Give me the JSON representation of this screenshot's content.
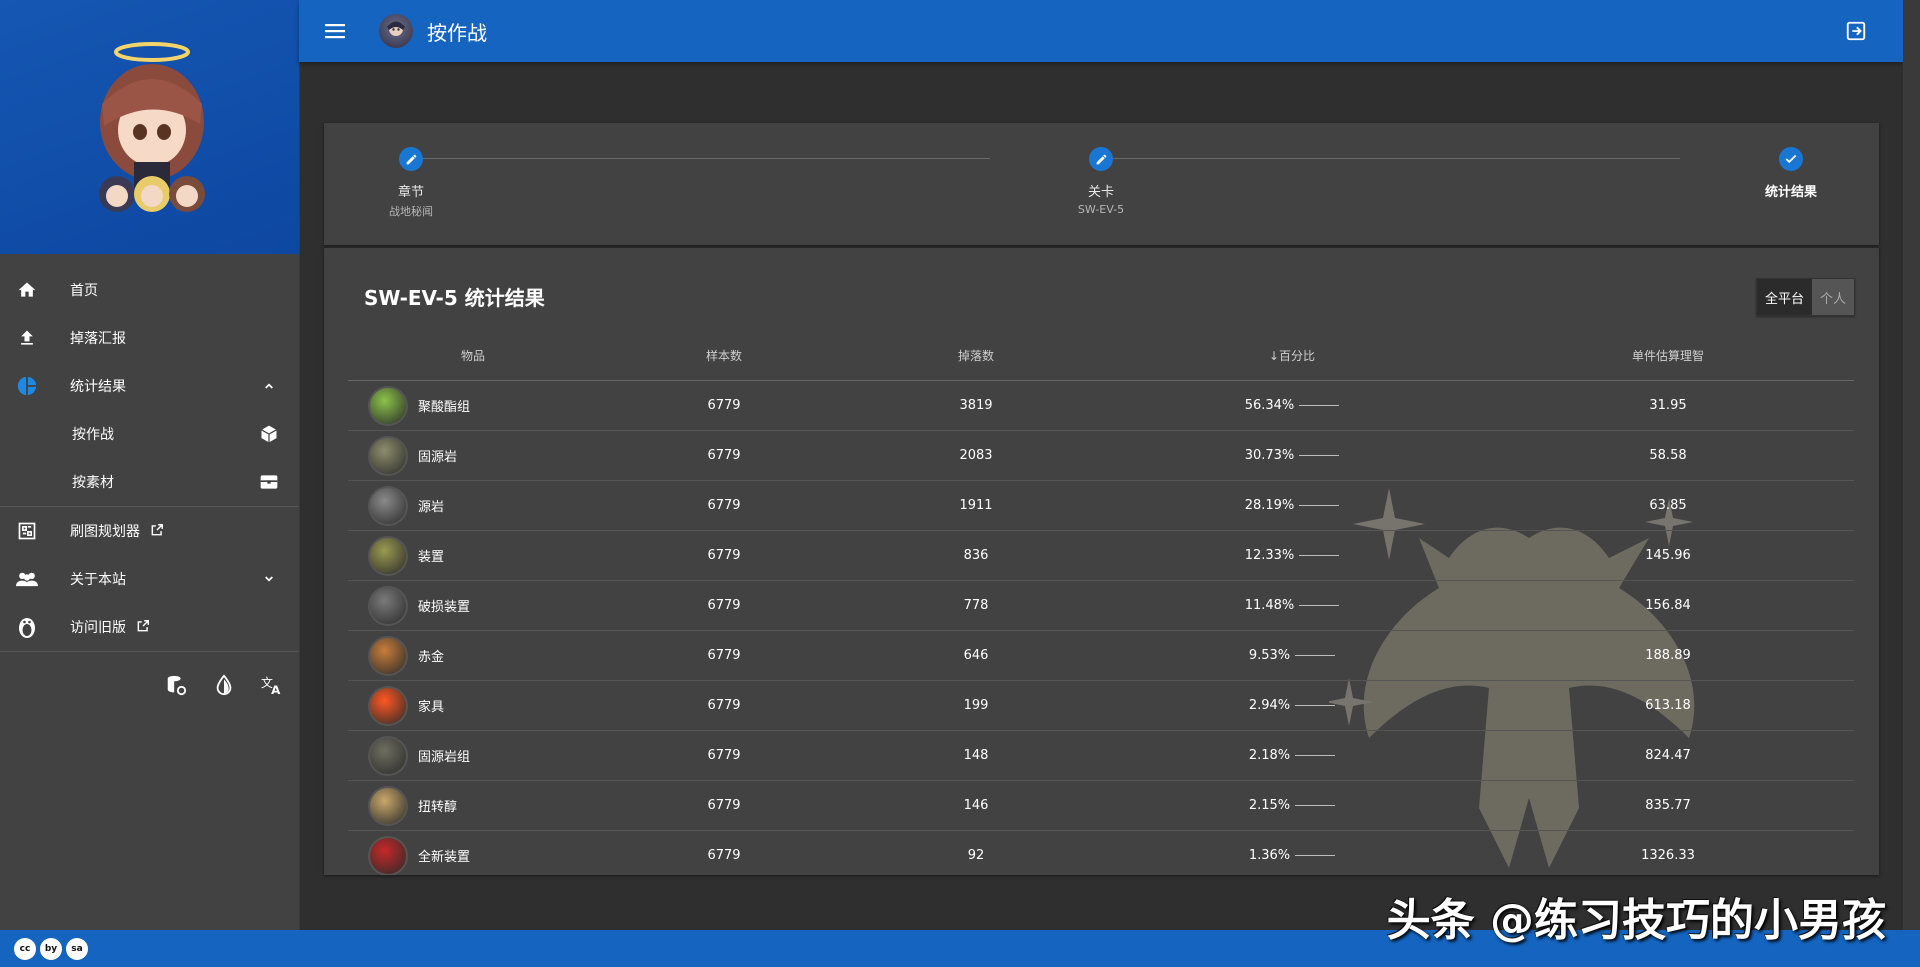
{
  "topbar": {
    "title": "按作战"
  },
  "sidebar": {
    "items": [
      {
        "label": "首页",
        "icon": "home-icon"
      },
      {
        "label": "掉落汇报",
        "icon": "upload-icon"
      },
      {
        "label": "统计结果",
        "icon": "pie-chart-icon",
        "expanded": true
      },
      {
        "label": "按作战",
        "icon": "cube-icon",
        "sub": true
      },
      {
        "label": "按素材",
        "icon": "box-icon",
        "sub": true
      },
      {
        "label": "刷图规划器",
        "icon": "planner-icon",
        "external": true
      },
      {
        "label": "关于本站",
        "icon": "people-icon"
      },
      {
        "label": "访问旧版",
        "icon": "penguin-icon",
        "external": true
      }
    ]
  },
  "stepper": {
    "steps": [
      {
        "label": "章节",
        "sub": "战地秘闻"
      },
      {
        "label": "关卡",
        "sub": "SW-EV-5"
      },
      {
        "label": "统计结果",
        "sub": ""
      }
    ]
  },
  "results": {
    "title": "SW-EV-5 统计结果",
    "toggle": {
      "all": "全平台",
      "personal": "个人"
    },
    "headers": {
      "item": "物品",
      "samples": "样本数",
      "drops": "掉落数",
      "percent": "百分比",
      "sanity": "单件估算理智"
    },
    "rows": [
      {
        "name": "聚酸酯组",
        "samples": "6779",
        "drops": "3819",
        "percent": "56.34%",
        "sanity": "31.95",
        "color": "#8bc34a"
      },
      {
        "name": "固源岩",
        "samples": "6779",
        "drops": "2083",
        "percent": "30.73%",
        "sanity": "58.58",
        "color": "#8d8d6b"
      },
      {
        "name": "源岩",
        "samples": "6779",
        "drops": "1911",
        "percent": "28.19%",
        "sanity": "63.85",
        "color": "#8a8a8a"
      },
      {
        "name": "装置",
        "samples": "6779",
        "drops": "836",
        "percent": "12.33%",
        "sanity": "145.96",
        "color": "#9a9a50"
      },
      {
        "name": "破损装置",
        "samples": "6779",
        "drops": "778",
        "percent": "11.48%",
        "sanity": "156.84",
        "color": "#7a7a7a"
      },
      {
        "name": "赤金",
        "samples": "6779",
        "drops": "646",
        "percent": "9.53%",
        "sanity": "188.89",
        "color": "#c77d3a"
      },
      {
        "name": "家具",
        "samples": "6779",
        "drops": "199",
        "percent": "2.94%",
        "sanity": "613.18",
        "color": "#ff5722"
      },
      {
        "name": "固源岩组",
        "samples": "6779",
        "drops": "148",
        "percent": "2.18%",
        "sanity": "824.47",
        "color": "#6e6e60"
      },
      {
        "name": "扭转醇",
        "samples": "6779",
        "drops": "146",
        "percent": "2.15%",
        "sanity": "835.77",
        "color": "#c9a86a"
      },
      {
        "name": "全新装置",
        "samples": "6779",
        "drops": "92",
        "percent": "1.36%",
        "sanity": "1326.33",
        "color": "#c62828"
      }
    ]
  },
  "footer": {
    "license": [
      "cc",
      "by",
      "sa"
    ]
  },
  "watermark": "头条 @练习技巧的小男孩"
}
